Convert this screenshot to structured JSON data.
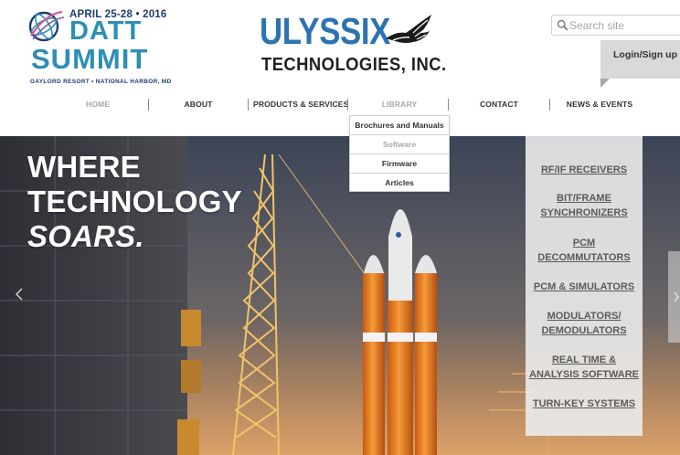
{
  "event_logo": {
    "date": "APRIL 25-28 • 2016",
    "line1": "DATT",
    "line2": "SUMMIT",
    "venue": "GAYLORD RESORT • NATIONAL HARBOR, MD"
  },
  "company_logo": {
    "name": "ULYSSIX",
    "subtitle": "TECHNOLOGIES, INC."
  },
  "search": {
    "placeholder": "Search site"
  },
  "login": {
    "label": "Login/Sign up"
  },
  "nav": {
    "items": [
      {
        "label": "HOME"
      },
      {
        "label": "ABOUT"
      },
      {
        "label": "PRODUCTS & SERVICES"
      },
      {
        "label": "LIBRARY"
      },
      {
        "label": "CONTACT"
      },
      {
        "label": "NEWS & EVENTS"
      }
    ]
  },
  "library_dropdown": {
    "items": [
      {
        "label": "Brochures and Manuals"
      },
      {
        "label": "Software"
      },
      {
        "label": "Firmware"
      },
      {
        "label": "Articles"
      }
    ]
  },
  "hero": {
    "line1": "WHERE",
    "line2": "TECHNOLOGY",
    "line3": "SOARS."
  },
  "products": {
    "items": [
      {
        "line1": "RF/IF RECEIVERS",
        "line2": ""
      },
      {
        "line1": "BIT/FRAME",
        "line2": "SYNCHRONIZERS"
      },
      {
        "line1": "PCM",
        "line2": "DECOMMUTATORS"
      },
      {
        "line1": "PCM & SIMULATORS",
        "line2": ""
      },
      {
        "line1": "MODULATORS/",
        "line2": "DEMODULATORS"
      },
      {
        "line1": "REAL TIME &",
        "line2": "ANALYSIS SOFTWARE"
      },
      {
        "line1": "TURN-KEY SYSTEMS",
        "line2": ""
      }
    ]
  },
  "colors": {
    "brand_blue": "#2b74b1",
    "summit_teal": "#2d8fb5",
    "rocket_orange": "#f07c1d"
  }
}
